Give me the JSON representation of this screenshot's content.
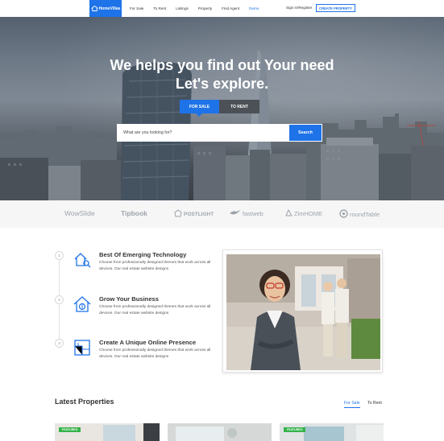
{
  "nav": {
    "logo_text": "HomeVillas",
    "links": [
      "For Sale",
      "To Rent",
      "Listings",
      "Property",
      "Find Agent",
      "Demo"
    ],
    "signin": "Sign in/Register",
    "create_button": "CREATE PROPERTY"
  },
  "hero": {
    "title_line1": "We helps you find out Your need",
    "title_line2": "Let's explore.",
    "tab_sale": "FOR SALE",
    "tab_rent": "TO RENT",
    "search_placeholder": "What are you looking for?",
    "search_button": "Search"
  },
  "partners": [
    "WowSlide",
    "Tipbook",
    "POSTLIGHT",
    "fastweb",
    "ZimHOME",
    "roundTable"
  ],
  "features": [
    {
      "step": "1",
      "icon": "house-key-icon",
      "title": "Best Of Emerging Technology",
      "desc": "Choose from professionally designed themes that work across all devices. Our real estate website designs"
    },
    {
      "step": "2",
      "icon": "house-dollar-icon",
      "title": "Grow Your Business",
      "desc": "Choose from professionally designed themes that work across all devices. Our real estate website designs"
    },
    {
      "step": "3",
      "icon": "blueprint-icon",
      "title": "Create A Unique Online Presence",
      "desc": "Choose from professionally designed themes that work across all devices. Our real estate website designs"
    }
  ],
  "latest": {
    "title": "Latest Properties",
    "tab_sale": "For Sale",
    "tab_rent": "To Rent",
    "badge": "FEATURED"
  },
  "colors": {
    "accent": "#1e73e8",
    "featured": "#35b34a"
  }
}
